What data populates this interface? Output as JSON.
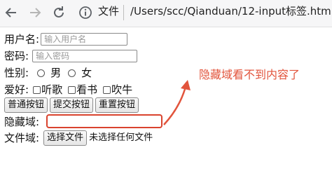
{
  "browser": {
    "address_label": "文件",
    "url": "/Users/scc/Qianduan/12-input标签.html",
    "icons": [
      "back-arrow-icon",
      "forward-arrow-icon",
      "reload-icon",
      "info-icon"
    ]
  },
  "form": {
    "username": {
      "label": "用户名:",
      "placeholder": "输入用户名"
    },
    "password": {
      "label": "密码:",
      "placeholder": "输入密码"
    },
    "gender": {
      "label": "性别:",
      "options": [
        "男",
        "女"
      ]
    },
    "hobbies": {
      "label": "爱好:",
      "options": [
        "听歌",
        "看书",
        "吹牛"
      ]
    },
    "buttons": [
      "普通按钮",
      "提交按钮",
      "重置按钮"
    ],
    "hidden": {
      "label": "隐藏域:"
    },
    "file": {
      "label": "文件域:",
      "button": "选择文件",
      "status": "未选择任何文件"
    }
  },
  "annotation": {
    "text": "隐藏域看不到内容了",
    "color": "#e2543c"
  }
}
